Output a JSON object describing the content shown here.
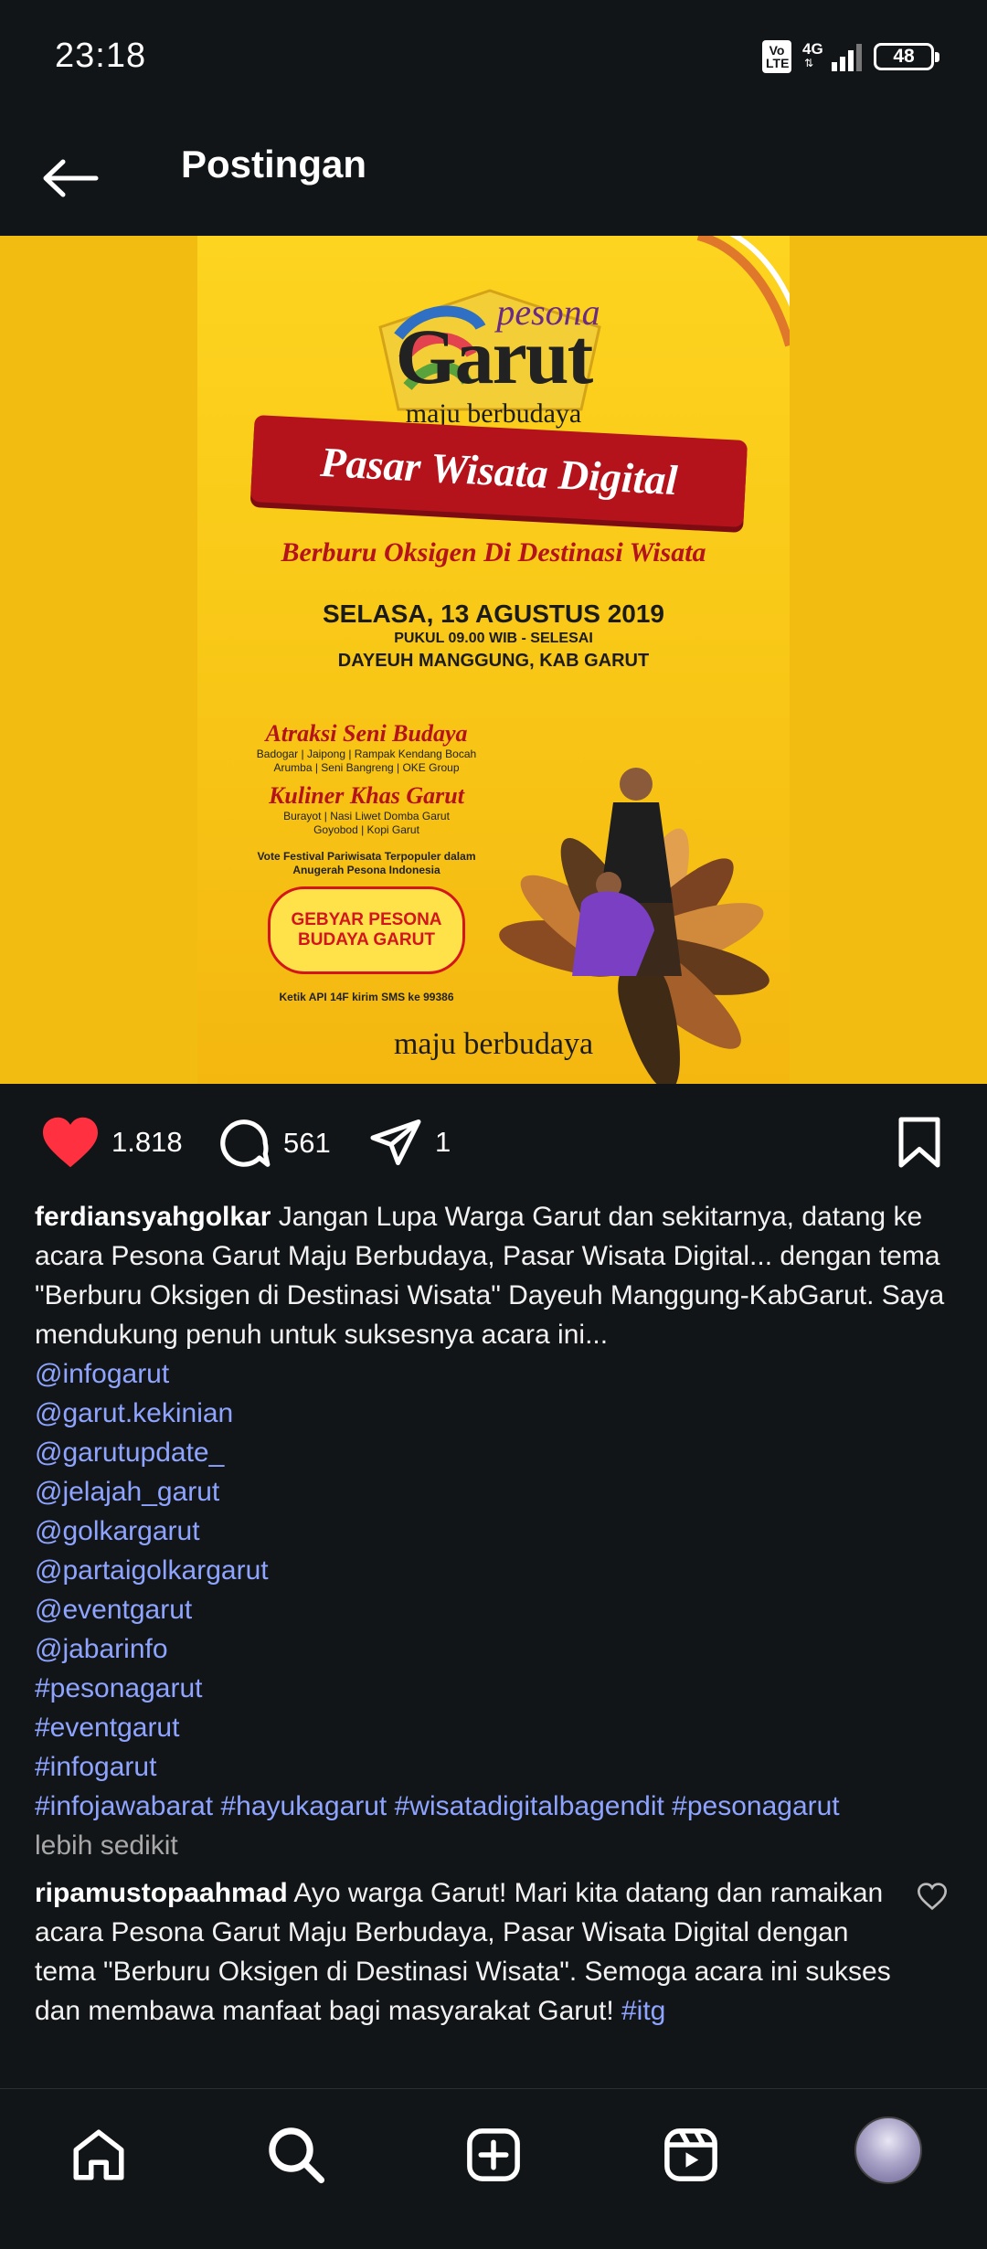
{
  "status_bar": {
    "time": "23:18",
    "network_badge": "Vo\nLTE",
    "network_type": "4G",
    "battery": "48"
  },
  "header": {
    "title": "Postingan"
  },
  "poster": {
    "logo_pesona": "pesona",
    "logo_garut": "Garut",
    "logo_tagline": "maju berbudaya",
    "ribbon": "Pasar Wisata Digital",
    "slogan": "Berburu Oksigen Di Destinasi Wisata",
    "date": "SELASA, 13 AGUSTUS 2019",
    "time": "PUKUL 09.00 WIB - SELESAI",
    "place": "DAYEUH MANGGUNG, KAB GARUT",
    "section1_title": "Atraksi Seni Budaya",
    "section1_items": "Badogar | Jaipong | Rampak Kendang Bocah\nArumba | Seni Bangreng | OKE Group",
    "section2_title": "Kuliner Khas Garut",
    "section2_items": "Burayot | Nasi Liwet Domba Garut\nGoyobod | Kopi Garut",
    "vote_text": "Vote Festival Pariwisata Terpopuler dalam Anugerah Pesona Indonesia",
    "badge_line1": "GEBYAR PESONA",
    "badge_line2": "BUDAYA GARUT",
    "sms": "Ketik API 14F kirim SMS ke 99386",
    "footer": "maju berbudaya"
  },
  "actions": {
    "likes": "1.818",
    "comments": "561",
    "shares": "1"
  },
  "caption": {
    "username": "ferdiansyahgolkar",
    "text": "Jangan Lupa Warga Garut dan sekitarnya, datang ke acara Pesona Garut Maju Berbudaya, Pasar Wisata Digital... dengan tema \"Berburu Oksigen di Destinasi Wisata\" Dayeuh Manggung-KabGarut. Saya mendukung penuh untuk suksesnya acara ini...",
    "tags": [
      "@infogarut",
      "@garut.kekinian",
      "@garutupdate_",
      "@jelajah_garut",
      "@golkargarut",
      "@partaigolkargarut",
      "@eventgarut",
      "@jabarinfo",
      "#pesonagarut",
      "#eventgarut",
      "#infogarut",
      "#infojawabarat #hayukagarut #wisatadigitalbagendit #pesonagarut"
    ],
    "less_label": "lebih sedikit"
  },
  "comment": {
    "username": "ripamustopaahmad",
    "text": "Ayo warga Garut! Mari kita datang dan ramaikan acara Pesona Garut Maju Berbudaya, Pasar Wisata Digital dengan tema \"Berburu Oksigen di Destinasi Wisata\". Semoga acara ini sukses dan membawa manfaat bagi masyarakat Garut!",
    "tag": "#itg"
  },
  "colors": {
    "background": "#121517",
    "like_red": "#ff3040",
    "link_blue": "#8ea4ff",
    "poster_yellow": "#f8c616"
  },
  "icons": {
    "back": "arrow-left-icon",
    "like": "heart-filled-icon",
    "comment": "speech-bubble-icon",
    "share": "paper-plane-icon",
    "save": "bookmark-icon",
    "home": "home-icon",
    "search": "search-icon",
    "create": "plus-square-icon",
    "reels": "reels-icon"
  }
}
